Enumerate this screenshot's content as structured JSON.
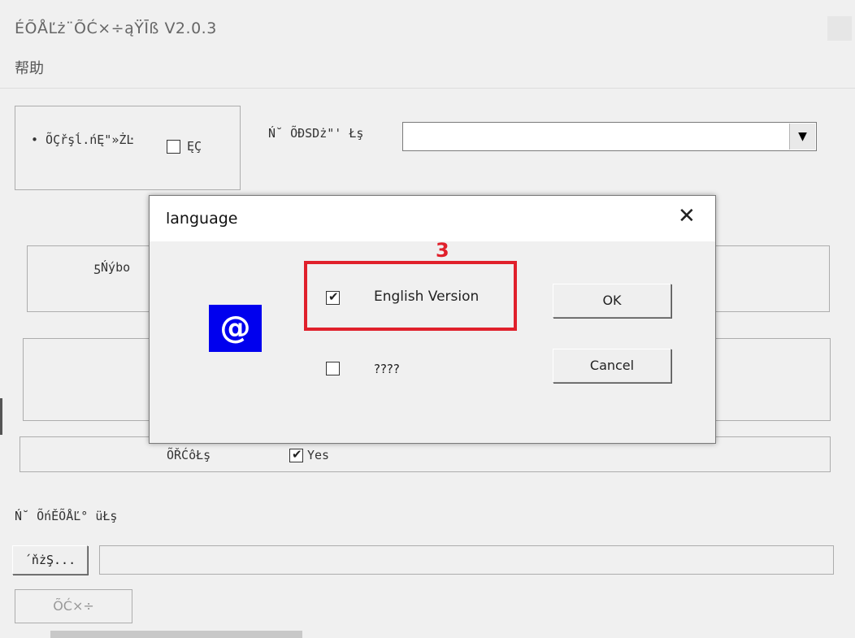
{
  "window": {
    "title": "ÉÕÅĽż¨ÕĆ×÷ąŸĪß V2.0.3"
  },
  "menu": {
    "help": "帮助"
  },
  "group1": {
    "label": "• ÕÇřşĺ.ńĘ\"»ŻĿ",
    "checkbox_label": "ĘÇ",
    "checked": false
  },
  "combo": {
    "label": "Ń˘ ÕĐSDż\"' Łş",
    "value": ""
  },
  "panel_a": {
    "label": "ƽŃýbo"
  },
  "status_row": {
    "label": "ÕŘĆôŁş",
    "checkbox_label": "Yes",
    "checked": true
  },
  "output": {
    "label": "Ń˘ ÕńĚÕÅĽ° üŁş",
    "browse_button": "´ňżŞ...",
    "path_value": ""
  },
  "action_button": "ÕĆ×÷",
  "dialog": {
    "title": "language",
    "icon_symbol": "@",
    "annotation_number": "3",
    "options": [
      {
        "label": "English Version",
        "checked": true
      },
      {
        "label": "????",
        "checked": false
      }
    ],
    "ok_label": "OK",
    "cancel_label": "Cancel"
  },
  "colors": {
    "highlight": "#e0202b",
    "icon_bg": "#0000ee"
  }
}
